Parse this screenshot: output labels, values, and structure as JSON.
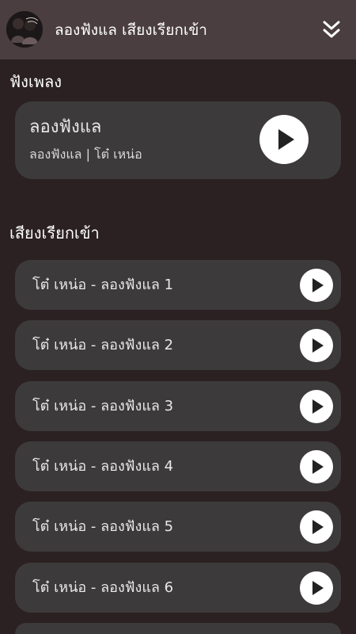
{
  "header": {
    "title": "ลองฟังแล เสียงเรียกเข้า",
    "avatar_icon": "avatar-photo",
    "collapse_icon": "double-chevron-down-icon"
  },
  "listen_section": {
    "title": "ฟังเพลง",
    "card": {
      "title": "ลองฟังแล",
      "subtitle": "ลองฟังแล | โต๋ เหน่อ",
      "play_icon": "play-icon"
    }
  },
  "ringtone_section": {
    "title": "เสียงเรียกเข้า",
    "items": [
      {
        "label": "โต๋ เหน่อ - ลองฟังแล 1"
      },
      {
        "label": "โต๋ เหน่อ - ลองฟังแล 2"
      },
      {
        "label": "โต๋ เหน่อ - ลองฟังแล 3"
      },
      {
        "label": "โต๋ เหน่อ - ลองฟังแล 4"
      },
      {
        "label": "โต๋ เหน่อ - ลองฟังแล 5"
      },
      {
        "label": "โต๋ เหน่อ - ลองฟังแล 6"
      }
    ]
  },
  "colors": {
    "background": "#2b2122",
    "header": "#4a3e40",
    "card": "#3d3a3b",
    "play_button": "#ffffff",
    "play_glyph": "#222222"
  }
}
